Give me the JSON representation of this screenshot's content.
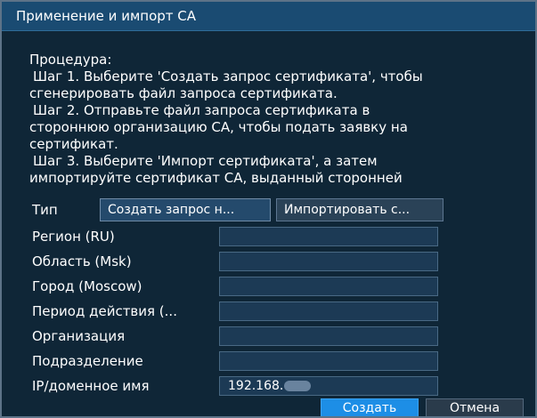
{
  "dialog": {
    "title": "Применение и импорт CA"
  },
  "procedure": {
    "heading": "Процедура:",
    "lines": [
      "Шаг 1. Выберите 'Создать запрос сертификата', чтобы",
      "сгенерировать файл запроса сертификата.",
      "Шаг 2. Отправьте файл запроса сертификата в",
      "стороннюю организацию CA, чтобы подать заявку на",
      "сертификат.",
      "Шаг 3. Выберите 'Импорт сертификата', а затем",
      "импортируйте сертификат CA, выданный сторонней"
    ]
  },
  "type": {
    "label": "Тип",
    "options": [
      "Создать запрос н...",
      "Импортировать с..."
    ],
    "selected_index": 0
  },
  "form": {
    "fields": [
      {
        "label": "Регион (RU)",
        "value": ""
      },
      {
        "label": "Область (Msk)",
        "value": ""
      },
      {
        "label": "Город (Moscow)",
        "value": ""
      },
      {
        "label": "Период действия (...",
        "value": ""
      },
      {
        "label": "Организация",
        "value": ""
      },
      {
        "label": "Подразделение",
        "value": ""
      },
      {
        "label": "IP/доменное имя",
        "value": "192.168."
      }
    ]
  },
  "buttons": {
    "create": "Создать",
    "cancel": "Отмена"
  },
  "colors": {
    "title_bar": "#1a4b72",
    "background": "#0f2637",
    "field_bg": "#1c3a55",
    "primary": "#1d8ee6"
  }
}
